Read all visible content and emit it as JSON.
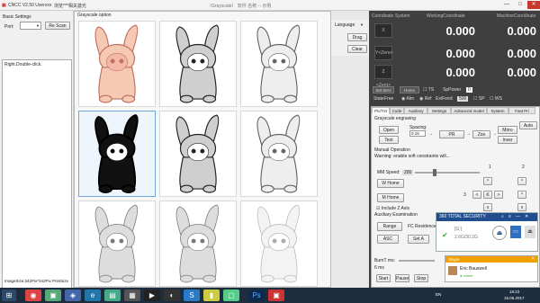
{
  "window": {
    "title": "CNCC V2.50  Userxxx",
    "subtitle": "浏览***相关激光",
    "center_title": "（Grayscale） 软件 名称 -- 示例",
    "min": "—",
    "max": "□",
    "close": "✕"
  },
  "left": {
    "section": "Basic Settings",
    "port_label": "Port:",
    "port_value": "",
    "rescan": "Re Scan",
    "log_line": "Right.Double-click.",
    "image_size": "ImageSize:342Pix*342Pix  PrintSize"
  },
  "gray": {
    "title": "Grayscale option",
    "thumbs": [
      "thumb-1",
      "thumb-2",
      "thumb-3",
      "thumb-4",
      "thumb-5",
      "thumb-6",
      "thumb-7",
      "thumb-8",
      "thumb-9"
    ]
  },
  "lang": {
    "label": "Language",
    "drag": "Drag",
    "clear": "Clear"
  },
  "coords": {
    "h_system": "Coordinate System",
    "h_working": "WorkingCoordinate",
    "h_machine": "MachineCoordinate",
    "x_btn": "X",
    "y_btn": "Y<Zero>",
    "z_btn": "Z <Zero>",
    "x_work": "0.000",
    "x_mach": "0.000",
    "y_work": "0.000",
    "y_mach": "0.000",
    "z_work": "0.000",
    "z_mach": "0.000"
  },
  "controls": {
    "set_zero": "Set Zero",
    "home": "Home",
    "ts": "TS",
    "sp_power": "SpPower",
    "sp_power_val": "0",
    "state": "State",
    "state_val": "Free",
    "alm": "Alm",
    "ref": "Ref",
    "ext_feed": "ExtFeed",
    "ext_feed_val": "500",
    "sp": "SP",
    "ws": "WS"
  },
  "tabs": [
    "Pic/Txt",
    "Code",
    "Auxiliary",
    "Settings",
    "Advanced model",
    "System",
    "Fast Pri"
  ],
  "engrave": {
    "title": "Grayscale engraving",
    "auto": "Auto",
    "open": "Open",
    "spacing_label": "Spacing:",
    "spacing_val": "0.15",
    "pr": "PR",
    "zoo": "Zoo",
    "mirro": "Mirro",
    "text": "Text",
    "inver": "Inver",
    "manual_op": "Manual Operation",
    "warning": "Warning: enable soft constraints will...",
    "mm_speed": "MM Speed:",
    "mm_speed_val": "200",
    "jog_num1": "1",
    "jog_num2": "2",
    "jog_num3": "3",
    "w_home": "W Home",
    "m_home": "M Home",
    "include_z": "Include Z Axis",
    "aux_exam": "Auxiliary Examination",
    "range": "Range",
    "fc_residence": "FC Residence",
    "asc": "ASC",
    "seta": "Set A",
    "burn_t": "BurnT ms:",
    "burn_val": "6 ms",
    "start": "Start",
    "pause": "Pause",
    "stop": "Stop",
    "up": "^",
    "down": "v",
    "left": "<",
    "right": ">",
    "k": "K"
  },
  "security": {
    "title": "360 TOTAL SECURITY",
    "drive": "[G:]",
    "size": "2.6G/30.2G"
  },
  "skype": {
    "title": "Skype",
    "name": "Eric Bauswell",
    "status": "● online"
  },
  "taskbar": {
    "lang": "EN",
    "time": "18:23",
    "date": "15.06.2017"
  },
  "colors": {
    "accent": "#1f4d8f",
    "coord_bg": "#3f3f3f",
    "taskbar": "#1d2d3d"
  }
}
